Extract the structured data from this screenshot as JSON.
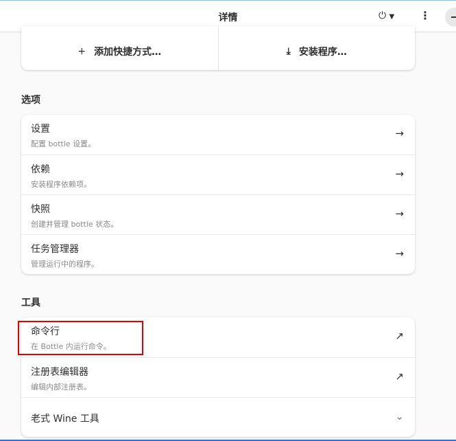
{
  "header": {
    "title": "详情"
  },
  "actions": {
    "add_shortcut": "添加快捷方式…",
    "install": "安装程序…"
  },
  "options": {
    "heading": "选项",
    "items": [
      {
        "title": "设置",
        "subtitle": "配置 bottle 设置。"
      },
      {
        "title": "依赖",
        "subtitle": "安装程序依赖项。"
      },
      {
        "title": "快照",
        "subtitle": "创建并管理 bottle 状态。"
      },
      {
        "title": "任务管理器",
        "subtitle": "管理运行中的程序。"
      }
    ]
  },
  "tools": {
    "heading": "工具",
    "items": [
      {
        "title": "命令行",
        "subtitle": "在 Bottle 内运行命令。"
      },
      {
        "title": "注册表编辑器",
        "subtitle": "编辑内部注册表。"
      },
      {
        "title": "老式 Wine 工具"
      }
    ]
  }
}
